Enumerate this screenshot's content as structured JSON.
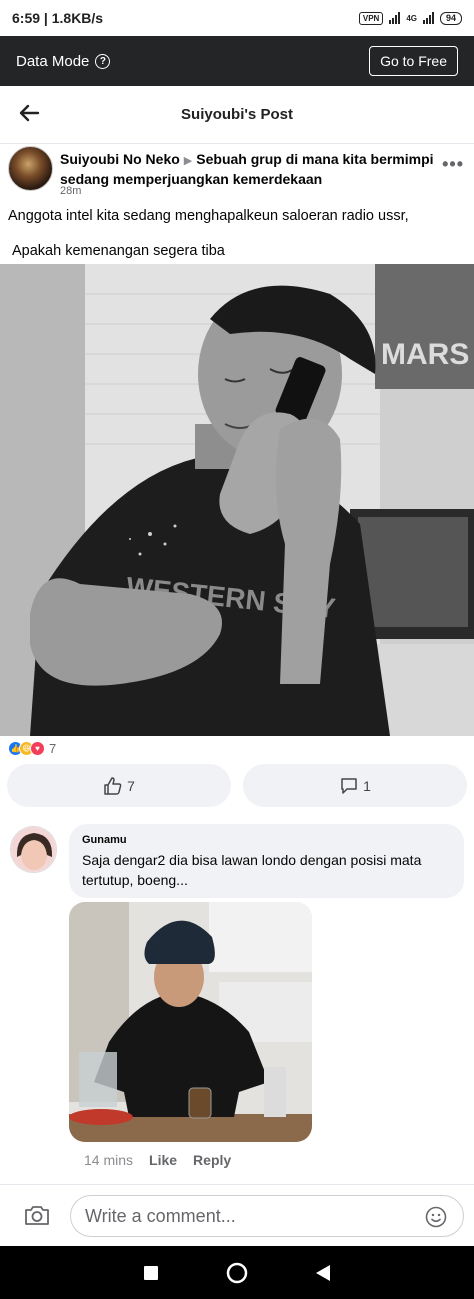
{
  "status_bar": {
    "time": "6:59",
    "speed": "1.8KB/s",
    "vpn": "VPN",
    "network": "4G",
    "battery": "94"
  },
  "data_mode": {
    "label": "Data Mode",
    "help_icon": "?",
    "go_free": "Go to Free"
  },
  "header": {
    "title": "Suiyoubi's Post",
    "back_icon": "arrow-left-icon"
  },
  "post": {
    "author": "Suiyoubi No Neko",
    "group": "Sebuah grup di mana kita bermimpi sedang memperjuangkan kemerdekaan",
    "time": "28m",
    "more": "•••",
    "text_line1": "Anggota intel kita sedang menghapalkeun saloeran radio ussr,",
    "text_line2": "Apakah kemenangan segera tiba",
    "photo_shirt_text": "WESTERN SITY",
    "photo_poster_text": "MARS",
    "reactions_count": "7",
    "like_count": "7",
    "comment_count": "1"
  },
  "comment": {
    "name": "Gunamu",
    "text": "Saja dengar2 dia bisa lawan londo  dengan posisi mata tertutup, boeng...",
    "time": "14 mins",
    "like": "Like",
    "reply": "Reply"
  },
  "composer": {
    "placeholder": "Write a comment..."
  },
  "colors": {
    "fb_blue": "#1877f2",
    "dark_bar": "#242526",
    "bubble_bg": "#f0f2f5"
  },
  "icons": [
    "arrow-left-icon",
    "help-icon",
    "more-icon",
    "like-reaction-icon",
    "haha-reaction-icon",
    "love-reaction-icon",
    "thumbs-up-icon",
    "comment-icon",
    "camera-icon",
    "emoji-icon",
    "square-nav-icon",
    "circle-nav-icon",
    "triangle-back-nav-icon"
  ]
}
